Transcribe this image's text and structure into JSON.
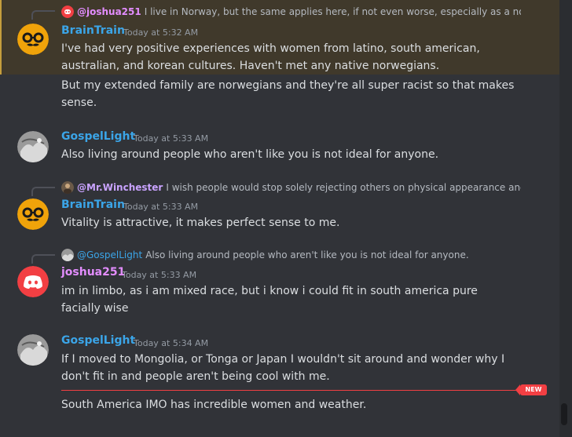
{
  "colors": {
    "background": "#313338",
    "highlight": "#40392b",
    "new_marker": "#f23f43",
    "name_gospel": "#3ba5e8",
    "name_braintrain": "#3ba5e8",
    "name_joshua": "#e38dff"
  },
  "messages": [
    {
      "author": "BrainTrain",
      "timestamp": "Today at 5:32 AM",
      "reply_to": {
        "author": "@joshua251",
        "text": "I live in Norway, but the same applies here, if not even worse, especially as a non-na"
      },
      "lines": [
        "I've had very positive experiences with women from latino, south american,",
        "australian, and korean cultures. Haven't met any native norwegians."
      ],
      "followups": [
        "But my extended family are norwegians and they're all super racist so that makes sense."
      ]
    },
    {
      "author": "GospelLight",
      "timestamp": "Today at 5:33 AM",
      "lines": [
        "Also living around people who aren't like you is not ideal for anyone."
      ]
    },
    {
      "author": "BrainTrain",
      "timestamp": "Today at 5:33 AM",
      "reply_to": {
        "author": "@Mr.Winchester",
        "text": "I wish people would stop solely rejecting others on physical appearance and at"
      },
      "lines": [
        "Vitality is attractive, it makes perfect sense to me."
      ]
    },
    {
      "author": "joshua251",
      "timestamp": "Today at 5:33 AM",
      "reply_to": {
        "author": "@GospelLight",
        "text": "Also living around people who aren't like you is not ideal for anyone."
      },
      "lines": [
        "im in limbo, as i am mixed race, but i know i could fit in south america pure facially wise"
      ]
    },
    {
      "author": "GospelLight",
      "timestamp": "Today at 5:34 AM",
      "lines": [
        "If I moved to Mongolia, or Tonga or Japan I wouldn't sit around and wonder why I don't fit in and people aren't being cool with me."
      ],
      "followups": [
        "South America IMO has incredible women and weather."
      ]
    }
  ],
  "new_badge": "NEW"
}
